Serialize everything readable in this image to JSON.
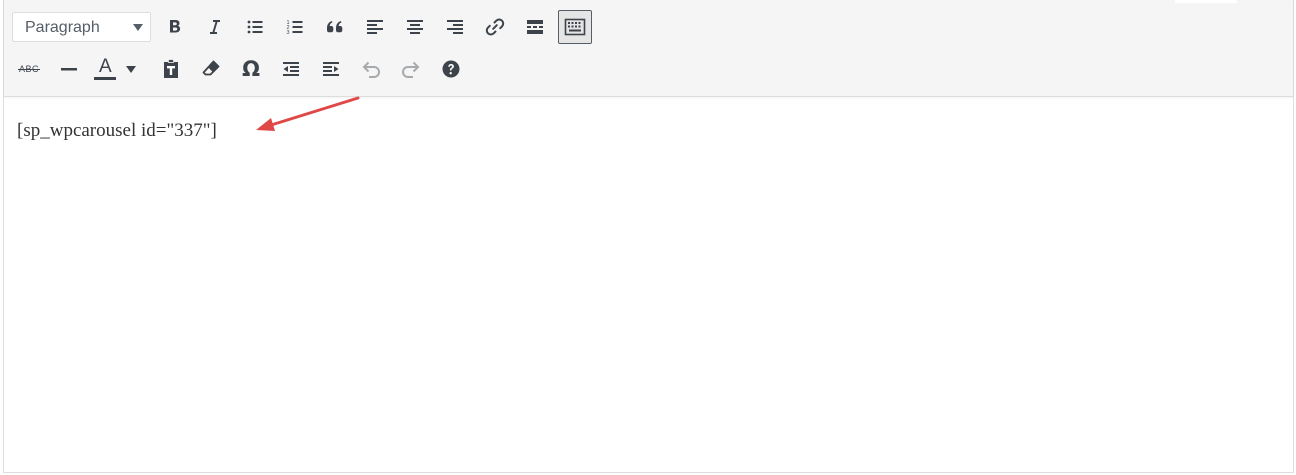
{
  "toolbar": {
    "format_select": {
      "value": "Paragraph"
    },
    "row1_buttons": [
      {
        "icon": "bold-icon"
      },
      {
        "icon": "italic-icon"
      },
      {
        "icon": "bulleted-list-icon"
      },
      {
        "icon": "numbered-list-icon"
      },
      {
        "icon": "blockquote-icon"
      },
      {
        "icon": "align-left-icon"
      },
      {
        "icon": "align-center-icon"
      },
      {
        "icon": "align-right-icon"
      },
      {
        "icon": "link-icon"
      },
      {
        "icon": "read-more-icon"
      },
      {
        "icon": "toolbar-toggle-icon"
      }
    ],
    "row2_buttons": [
      {
        "icon": "strikethrough-icon"
      },
      {
        "icon": "horizontal-line-icon"
      },
      {
        "icon": "text-color-icon"
      },
      {
        "icon": "paste-as-text-icon"
      },
      {
        "icon": "clear-formatting-icon"
      },
      {
        "icon": "special-character-icon"
      },
      {
        "icon": "outdent-icon"
      },
      {
        "icon": "indent-icon"
      },
      {
        "icon": "undo-icon"
      },
      {
        "icon": "redo-icon"
      },
      {
        "icon": "help-icon"
      }
    ],
    "strike_label": "ABC",
    "text_color_label": "A",
    "special_char_label": "Ω"
  },
  "editor": {
    "content": "[sp_wpcarousel id=\"337\"]"
  },
  "colors": {
    "icon": "#3c434a",
    "icon_disabled": "#a7aaad",
    "toolbar_bg": "#f5f5f5",
    "arrow": "#e04848"
  }
}
